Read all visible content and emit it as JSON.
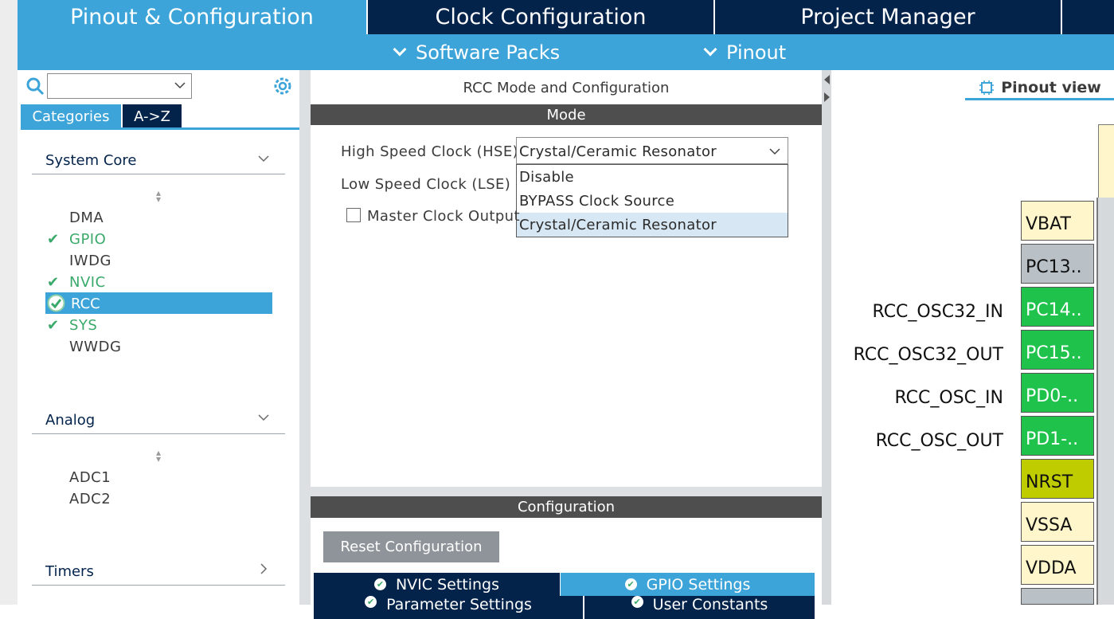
{
  "top_tabs": [
    {
      "label": "Pinout & Configuration"
    },
    {
      "label": "Clock Configuration"
    },
    {
      "label": "Project Manager"
    }
  ],
  "sub_tabs": [
    {
      "label": "Software Packs"
    },
    {
      "label": "Pinout"
    }
  ],
  "left": {
    "search_value": "",
    "category_tabs": [
      "Categories",
      "A->Z"
    ],
    "groups": [
      {
        "title": "System Core",
        "items": [
          {
            "label": "DMA",
            "status": "none"
          },
          {
            "label": "GPIO",
            "status": "configured"
          },
          {
            "label": "IWDG",
            "status": "none"
          },
          {
            "label": "NVIC",
            "status": "configured"
          },
          {
            "label": "RCC",
            "status": "selected"
          },
          {
            "label": "SYS",
            "status": "configured"
          },
          {
            "label": "WWDG",
            "status": "none"
          }
        ]
      },
      {
        "title": "Analog",
        "items": [
          {
            "label": "ADC1"
          },
          {
            "label": "ADC2"
          }
        ]
      },
      {
        "title": "Timers",
        "items": []
      }
    ]
  },
  "middle": {
    "title": "RCC Mode and Configuration",
    "mode_header": "Mode",
    "hse_label": "High Speed Clock (HSE)",
    "hse_value": "Crystal/Ceramic Resonator",
    "hse_options": [
      "Disable",
      "BYPASS Clock Source",
      "Crystal/Ceramic Resonator"
    ],
    "lse_label": "Low Speed Clock (LSE)",
    "mco_label": "Master Clock Output",
    "config_header": "Configuration",
    "reset_button": "Reset Configuration",
    "config_tabs": [
      "NVIC Settings",
      "GPIO Settings",
      "Parameter Settings",
      "User Constants"
    ]
  },
  "right": {
    "view_tab": "Pinout view",
    "pins": [
      {
        "label": "VBAT",
        "signal": ""
      },
      {
        "label": "PC13..",
        "signal": ""
      },
      {
        "label": "PC14..",
        "signal": "RCC_OSC32_IN"
      },
      {
        "label": "PC15..",
        "signal": "RCC_OSC32_OUT"
      },
      {
        "label": "PD0-..",
        "signal": "RCC_OSC_IN"
      },
      {
        "label": "PD1-..",
        "signal": "RCC_OSC_OUT"
      },
      {
        "label": "NRST",
        "signal": ""
      },
      {
        "label": "VSSA",
        "signal": ""
      },
      {
        "label": "VDDA",
        "signal": ""
      }
    ]
  },
  "colors": {
    "navy": "#03234b",
    "accent_blue": "#3ca4d9",
    "configured_green": "#3aa96a",
    "pin_green": "#1fc24b"
  }
}
